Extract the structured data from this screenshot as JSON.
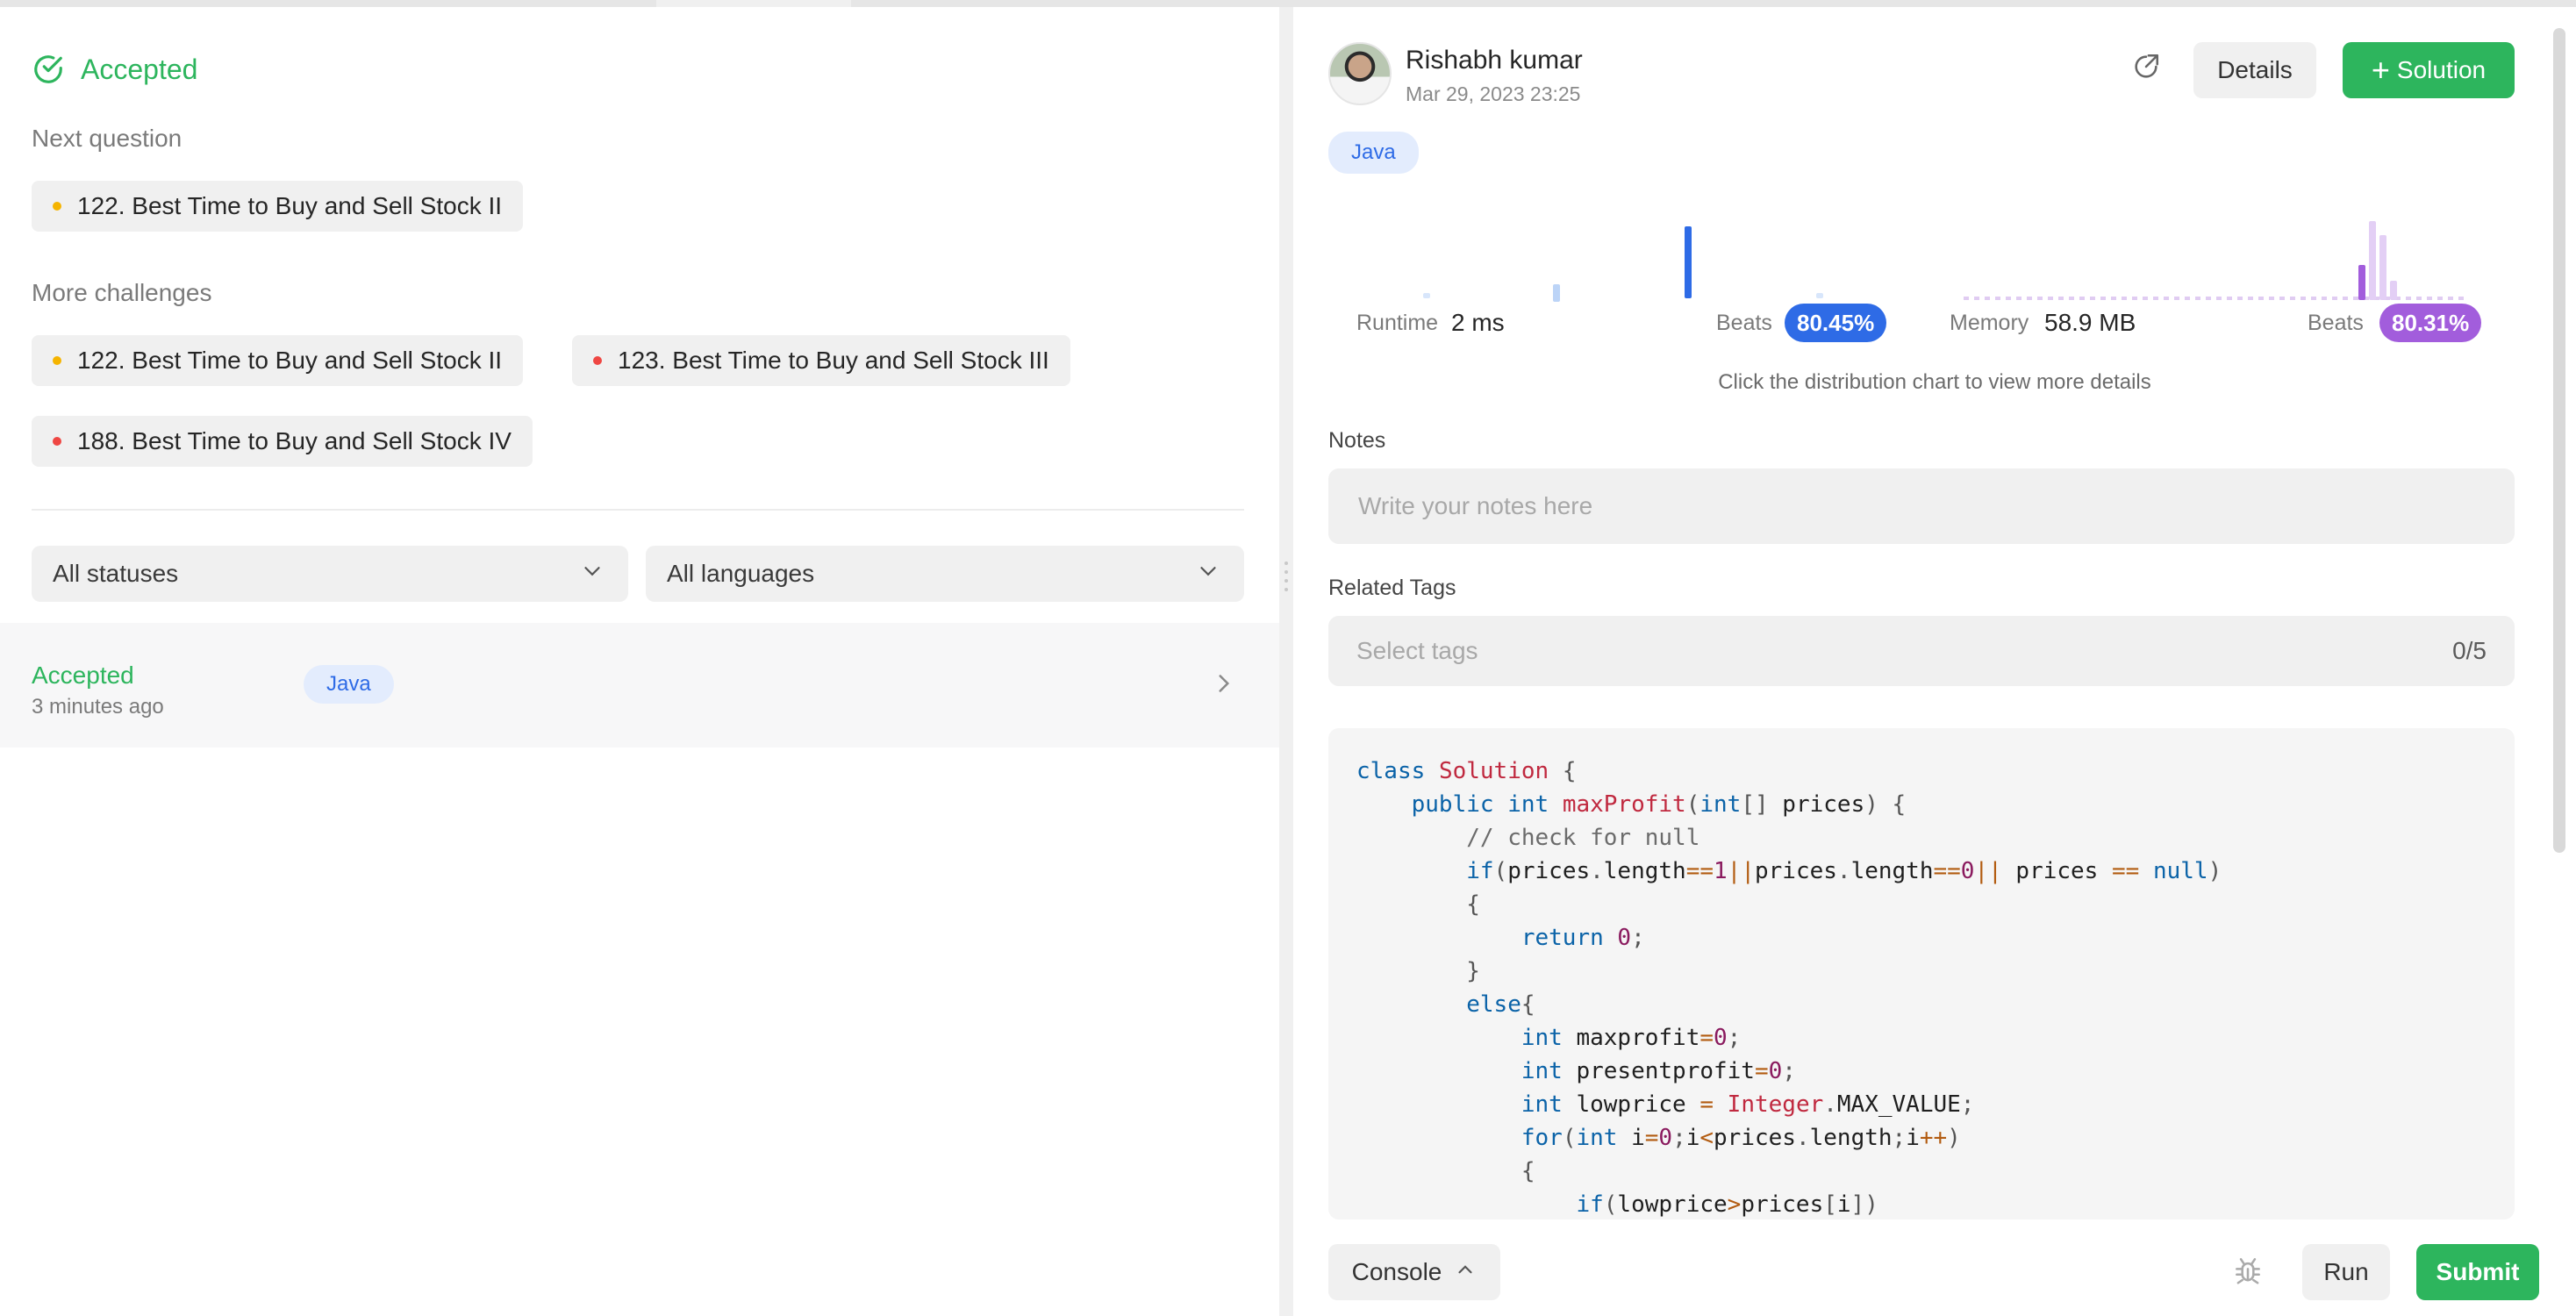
{
  "colors": {
    "accepted_green": "#2db55d",
    "runtime_blue": "#2e6be6",
    "memory_purple": "#a25ddc",
    "medium_dot": "#f5b400",
    "hard_dot": "#ef4743"
  },
  "status": {
    "title": "Accepted",
    "icon": "check-circle-icon"
  },
  "next_question": {
    "label": "Next question",
    "items": [
      {
        "title": "122. Best Time to Buy and Sell Stock II",
        "difficulty": "medium"
      }
    ]
  },
  "more_challenges": {
    "label": "More challenges",
    "items": [
      {
        "title": "122. Best Time to Buy and Sell Stock II",
        "difficulty": "medium"
      },
      {
        "title": "123. Best Time to Buy and Sell Stock III",
        "difficulty": "hard"
      },
      {
        "title": "188. Best Time to Buy and Sell Stock IV",
        "difficulty": "hard"
      }
    ]
  },
  "filters": {
    "status_selected": "All statuses",
    "language_selected": "All languages"
  },
  "submissions": [
    {
      "status": "Accepted",
      "time": "3 minutes ago",
      "language": "Java"
    }
  ],
  "detail": {
    "user_name": "Rishabh kumar",
    "date": "Mar 29, 2023 23:25",
    "details_label": "Details",
    "solution_label": "Solution",
    "language": "Java",
    "runtime_label": "Runtime",
    "runtime_value": "2 ms",
    "runtime_beats_label": "Beats",
    "runtime_beats": "80.45%",
    "memory_label": "Memory",
    "memory_value": "58.9 MB",
    "memory_beats_label": "Beats",
    "memory_beats": "80.31%",
    "chart_hint": "Click the distribution chart to view more details",
    "notes_label": "Notes",
    "notes_placeholder": "Write your notes here",
    "tags_label": "Related Tags",
    "tags_placeholder": "Select tags",
    "tags_count": "0/5"
  },
  "code_lines": [
    "class Solution {",
    "    public int maxProfit(int[] prices) {",
    "        // check for null",
    "        if(prices.length==1||prices.length==0|| prices == null)",
    "        {",
    "            return 0;",
    "        }",
    "        else{",
    "            int maxprofit=0;",
    "            int presentprofit=0;",
    "            int lowprice = Integer.MAX_VALUE;",
    "            for(int i=0;i<prices.length;i++)",
    "            {",
    "                if(lowprice>prices[i])"
  ],
  "bottom": {
    "console_label": "Console",
    "run_label": "Run",
    "submit_label": "Submit"
  }
}
